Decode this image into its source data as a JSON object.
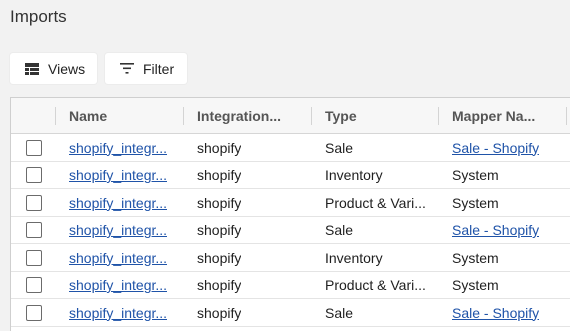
{
  "page": {
    "title": "Imports"
  },
  "toolbar": {
    "views_label": "Views",
    "filter_label": "Filter"
  },
  "table": {
    "columns": {
      "name": "Name",
      "integration": "Integration...",
      "type": "Type",
      "mapper": "Mapper Na..."
    },
    "rows": [
      {
        "name": "shopify_integr...",
        "integration": "shopify",
        "type": "Sale",
        "mapper": "Sale - Shopify",
        "mapper_link": true
      },
      {
        "name": "shopify_integr...",
        "integration": "shopify",
        "type": "Inventory",
        "mapper": "System",
        "mapper_link": false
      },
      {
        "name": "shopify_integr...",
        "integration": "shopify",
        "type": "Product & Vari...",
        "mapper": "System",
        "mapper_link": false
      },
      {
        "name": "shopify_integr...",
        "integration": "shopify",
        "type": "Sale",
        "mapper": "Sale - Shopify",
        "mapper_link": true
      },
      {
        "name": "shopify_integr...",
        "integration": "shopify",
        "type": "Inventory",
        "mapper": "System",
        "mapper_link": false
      },
      {
        "name": "shopify_integr...",
        "integration": "shopify",
        "type": "Product & Vari...",
        "mapper": "System",
        "mapper_link": false
      },
      {
        "name": "shopify_integr...",
        "integration": "shopify",
        "type": "Sale",
        "mapper": "Sale - Shopify",
        "mapper_link": true
      }
    ]
  },
  "colors": {
    "link": "#1f53a8",
    "header_bg": "#f7f7f7",
    "page_bg": "#f2f2f2"
  },
  "icons": {
    "views": "table-view-icon",
    "filter": "filter-lines-icon"
  }
}
